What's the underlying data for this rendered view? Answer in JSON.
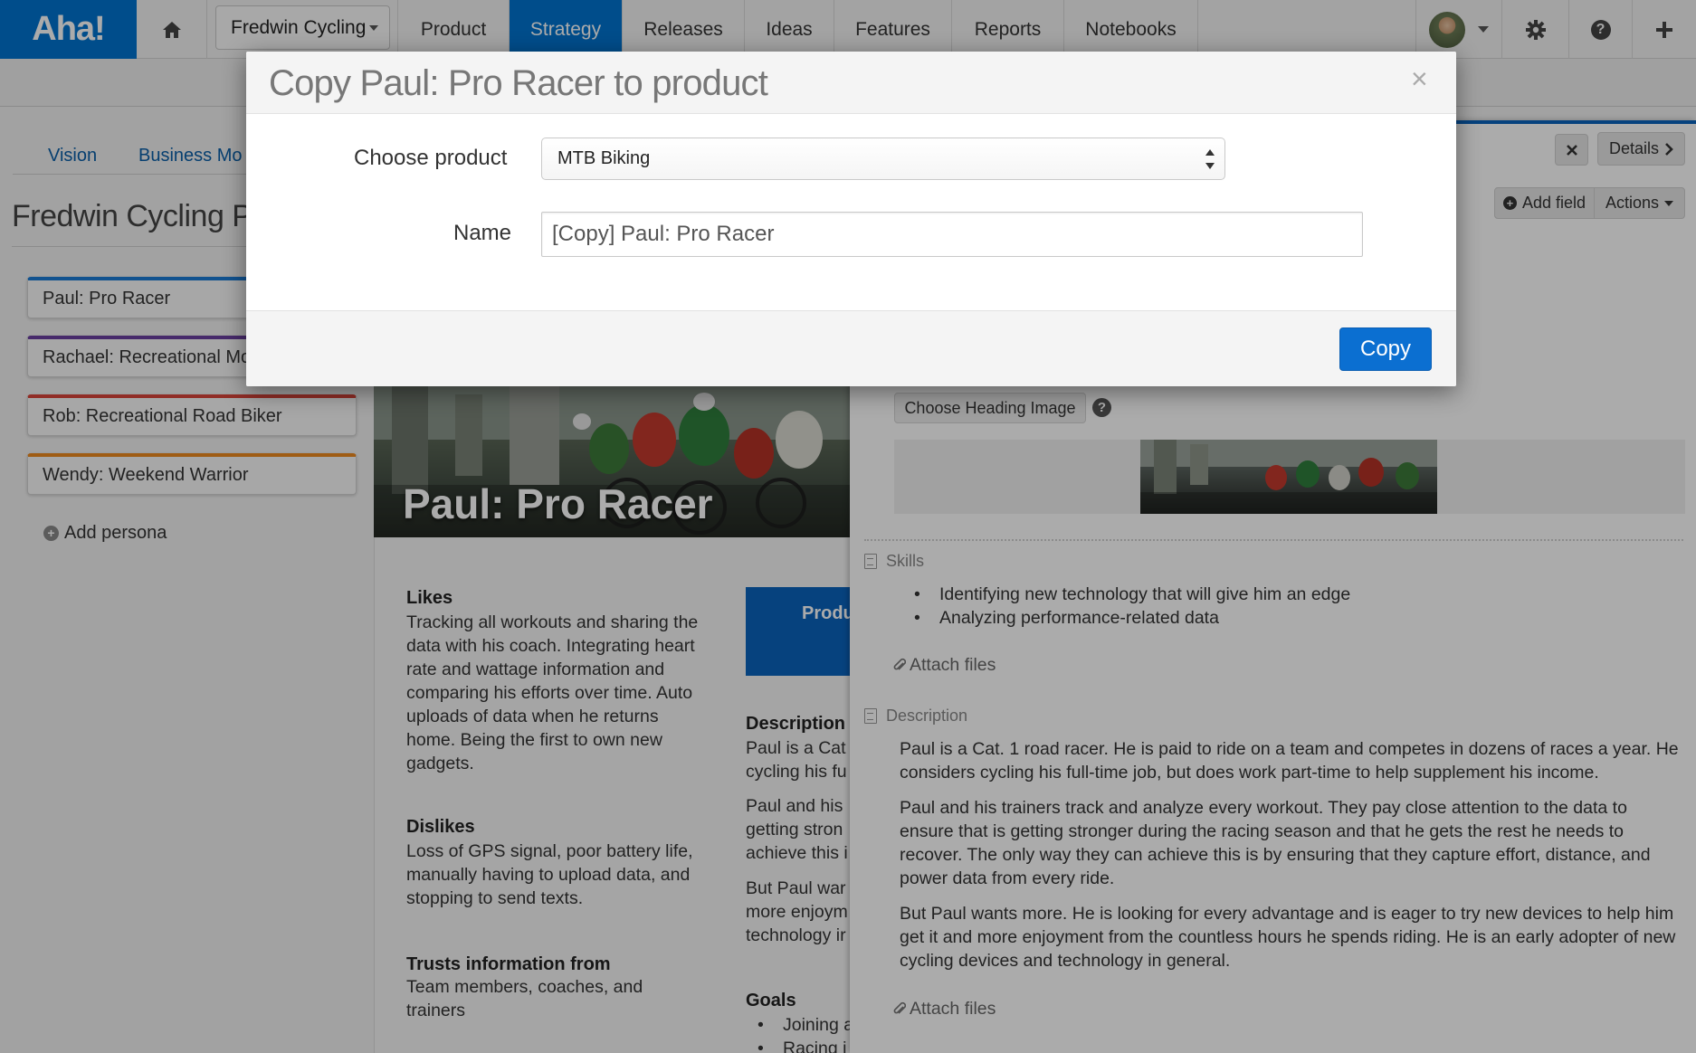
{
  "nav": {
    "logo": "Aha!",
    "product_selector": "Fredwin Cycling",
    "items": [
      "Product",
      "Strategy",
      "Releases",
      "Ideas",
      "Features",
      "Reports",
      "Notebooks"
    ],
    "active": "Strategy",
    "accent_color": "#0073cf"
  },
  "left": {
    "tabs": [
      "Vision",
      "Business Mo"
    ],
    "page_title": "Fredwin Cycling Pe",
    "personas": [
      {
        "label": "Paul: Pro Racer",
        "color": "#1a7bd6"
      },
      {
        "label": "Rachael: Recreational Mo",
        "color": "#6a3fa0"
      },
      {
        "label": "Rob: Recreational Road Biker",
        "color": "#d9443a"
      },
      {
        "label": "Wendy: Weekend Warrior",
        "color": "#ee8a1f"
      }
    ],
    "add_persona": "Add persona"
  },
  "persona": {
    "hero_title": "Paul: Pro Racer",
    "likes_head": "Likes",
    "likes_lines": [
      "Tracking all workouts and sharing the",
      "data with his coach. Integrating heart",
      "rate and wattage information and",
      "comparing his efforts over time. Auto",
      "uploads of data when he returns",
      "home. Being the first to own new",
      "gadgets."
    ],
    "dislikes_head": "Dislikes",
    "dislikes_lines": [
      "Loss of GPS signal, poor battery life,",
      "manually having to upload data, and",
      "stopping to send texts."
    ],
    "trusts_head": "Trusts information from",
    "trusts_lines": [
      "Team members, coaches, and",
      "trainers"
    ],
    "product_box": "Produ",
    "description_head": "Description",
    "desc_lines": [
      "Paul is a Cat",
      "cycling his fu"
    ],
    "desc_lines2": [
      "Paul and his",
      "getting stron",
      "achieve this i"
    ],
    "desc_lines3": [
      "But Paul war",
      "more enjoym",
      "technology ir"
    ],
    "goals_head": "Goals",
    "goals": [
      "Joining a",
      "Racing i"
    ]
  },
  "right": {
    "details_button": "Details",
    "add_field": "Add field",
    "actions": "Actions",
    "choose_heading_image": "Choose Heading Image",
    "skills_label": "Skills",
    "skills": [
      "Identifying new technology that will give him an edge",
      "Analyzing performance-related data"
    ],
    "attach_files": "Attach files",
    "description_label": "Description",
    "description_paragraphs": [
      "Paul is a Cat. 1 road racer. He is paid to ride on a team and competes in dozens of races a year. He considers cycling his full-time job, but does work part-time to help supplement his income.",
      "Paul and his trainers track and analyze every workout. They pay close attention to the data to ensure that is getting stronger during the racing season and that he gets the rest he needs to recover. The only way they can achieve this is by ensuring that they capture effort, distance, and power data from every ride.",
      "But Paul wants more. He is looking for every advantage and is eager to try new devices to help him get it and more enjoyment from the countless hours he spends riding. He is an early adopter of new cycling devices and technology in general."
    ]
  },
  "modal": {
    "title": "Copy Paul: Pro Racer to product",
    "close_symbol": "×",
    "choose_product_label": "Choose product",
    "selected_product": "MTB Biking",
    "name_label": "Name",
    "name_value": "[Copy] Paul: Pro Racer",
    "copy_button": "Copy",
    "primary_color": "#0b6fd1"
  }
}
